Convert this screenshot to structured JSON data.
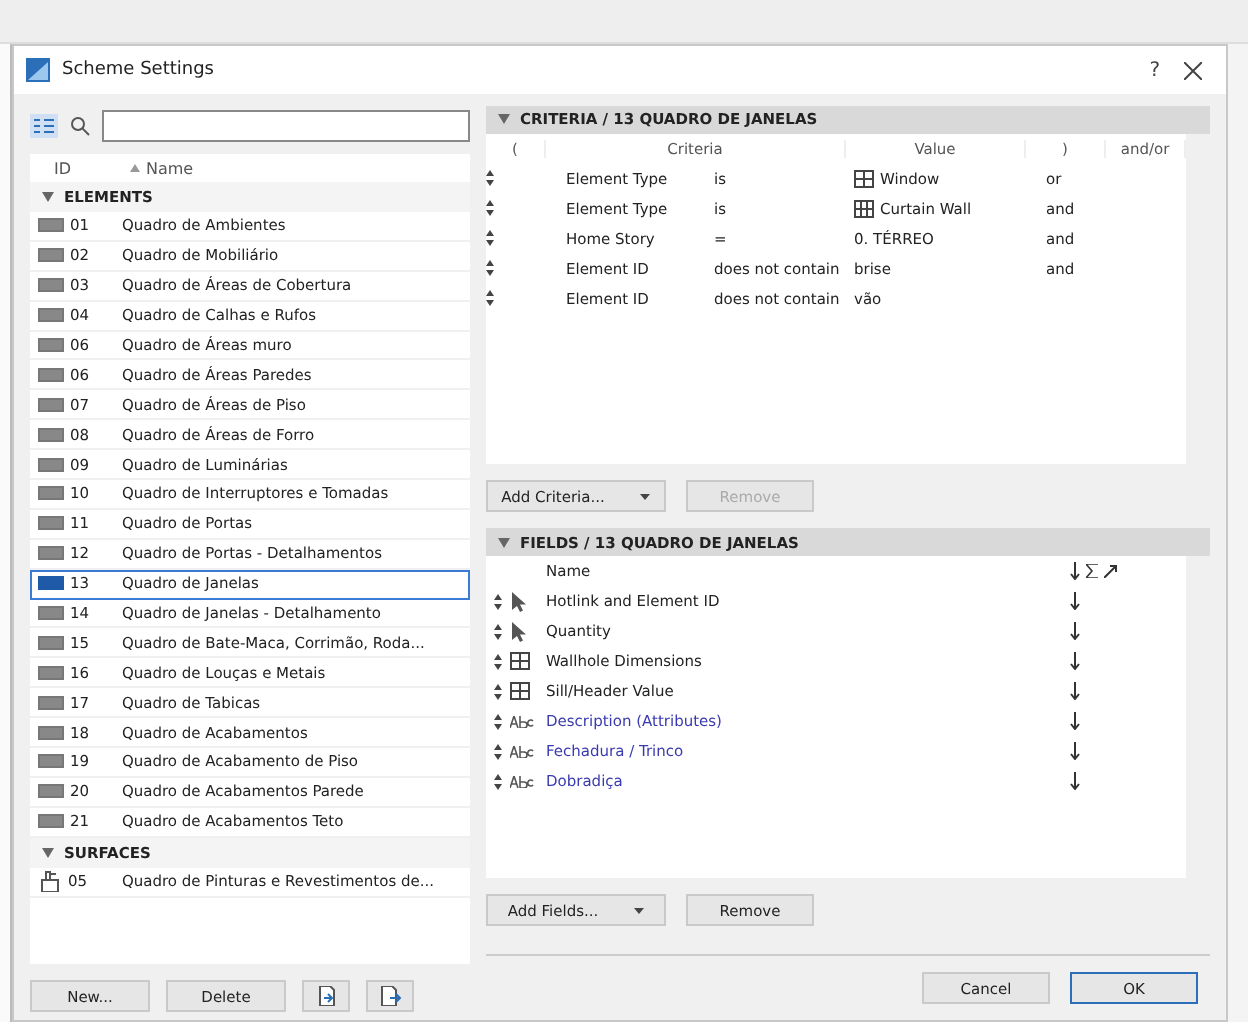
{
  "window": {
    "title": "Scheme Settings",
    "help": "?"
  },
  "list": {
    "columns": [
      "ID",
      "Name"
    ],
    "groups": [
      {
        "label": "ELEMENTS",
        "expanded": true,
        "items": [
          {
            "kind": "schedule",
            "id": "01",
            "name": "Quadro de Ambientes",
            "selected": false
          },
          {
            "kind": "schedule",
            "id": "02",
            "name": "Quadro de Mobiliário",
            "selected": false
          },
          {
            "kind": "schedule",
            "id": "03",
            "name": "Quadro de Áreas de Cobertura",
            "selected": false
          },
          {
            "kind": "schedule",
            "id": "04",
            "name": "Quadro de Calhas e Rufos",
            "selected": false
          },
          {
            "kind": "schedule",
            "id": "06",
            "name": "Quadro de Áreas muro",
            "selected": false
          },
          {
            "kind": "schedule",
            "id": "06",
            "name": "Quadro de Áreas Paredes",
            "selected": false
          },
          {
            "kind": "schedule",
            "id": "07",
            "name": "Quadro de Áreas de Piso",
            "selected": false
          },
          {
            "kind": "schedule",
            "id": "08",
            "name": "Quadro de Áreas de Forro",
            "selected": false
          },
          {
            "kind": "schedule",
            "id": "09",
            "name": "Quadro de Luminárias",
            "selected": false
          },
          {
            "kind": "schedule",
            "id": "10",
            "name": "Quadro de Interruptores e Tomadas",
            "selected": false
          },
          {
            "kind": "schedule",
            "id": "11",
            "name": "Quadro de Portas",
            "selected": false
          },
          {
            "kind": "schedule",
            "id": "12",
            "name": "Quadro de Portas - Detalhamentos",
            "selected": false
          },
          {
            "kind": "schedule",
            "id": "13",
            "name": "Quadro de Janelas",
            "selected": true
          },
          {
            "kind": "schedule",
            "id": "14",
            "name": "Quadro de Janelas - Detalhamento",
            "selected": false
          },
          {
            "kind": "schedule",
            "id": "15",
            "name": "Quadro de Bate-Maca, Corrimão, Roda...",
            "selected": false
          },
          {
            "kind": "schedule",
            "id": "16",
            "name": "Quadro de Louças e Metais",
            "selected": false
          },
          {
            "kind": "schedule",
            "id": "17",
            "name": "Quadro de Tabicas",
            "selected": false
          },
          {
            "kind": "schedule",
            "id": "18",
            "name": "Quadro de Acabamentos",
            "selected": false
          },
          {
            "kind": "schedule",
            "id": "19",
            "name": "Quadro de Acabamento de Piso",
            "selected": false
          },
          {
            "kind": "schedule",
            "id": "20",
            "name": "Quadro de Acabamentos Parede",
            "selected": false
          },
          {
            "kind": "schedule",
            "id": "21",
            "name": "Quadro de Acabamentos Teto",
            "selected": false
          }
        ]
      },
      {
        "label": "SURFACES",
        "expanded": true,
        "items": [
          {
            "kind": "surface",
            "id": "05",
            "name": "Quadro de Pinturas e Revestimentos de...",
            "selected": false
          }
        ]
      }
    ],
    "buttons": [
      "New...",
      "Delete"
    ]
  },
  "criteria": {
    "title": "CRITERIA / 13 QUADRO DE JANELAS",
    "expanded": true,
    "columns": [
      "(",
      "Criteria",
      "Value",
      ")",
      "and/or"
    ],
    "rows": [
      {
        "criterion": "Element Type",
        "operator": "is",
        "kind": "window",
        "value": "Window",
        "andor": "or"
      },
      {
        "criterion": "Element Type",
        "operator": "is",
        "kind": "curtainwall",
        "value": "Curtain Wall",
        "andor": "and"
      },
      {
        "criterion": "Home Story",
        "operator": "=",
        "kind": "plain",
        "value": "0. TÉRREO",
        "andor": "and"
      },
      {
        "criterion": "Element ID",
        "operator": "does not contain",
        "kind": "plain",
        "value": "brise",
        "andor": "and"
      },
      {
        "criterion": "Element ID",
        "operator": "does not contain",
        "kind": "plain",
        "value": "vão"
      }
    ],
    "add_button": "Add Criteria...",
    "remove_button": {
      "label": "Remove",
      "disabled": true
    }
  },
  "fields": {
    "title": "FIELDS / 13 QUADRO DE JANELAS",
    "expanded": true,
    "column": "Name",
    "rows": [
      {
        "kind": "element",
        "name": "Hotlink and Element ID"
      },
      {
        "kind": "element",
        "name": "Quantity"
      },
      {
        "kind": "window",
        "name": "Wallhole Dimensions"
      },
      {
        "kind": "window",
        "name": "Sill/Header Value"
      },
      {
        "kind": "text",
        "name": "Description (Attributes)"
      },
      {
        "kind": "text",
        "name": "Fechadura / Trinco"
      },
      {
        "kind": "text",
        "name": "Dobradiça"
      }
    ],
    "add_button": "Add Fields...",
    "remove_button": {
      "label": "Remove",
      "disabled": false
    }
  },
  "footer": {
    "cancel": "Cancel",
    "ok": "OK"
  }
}
